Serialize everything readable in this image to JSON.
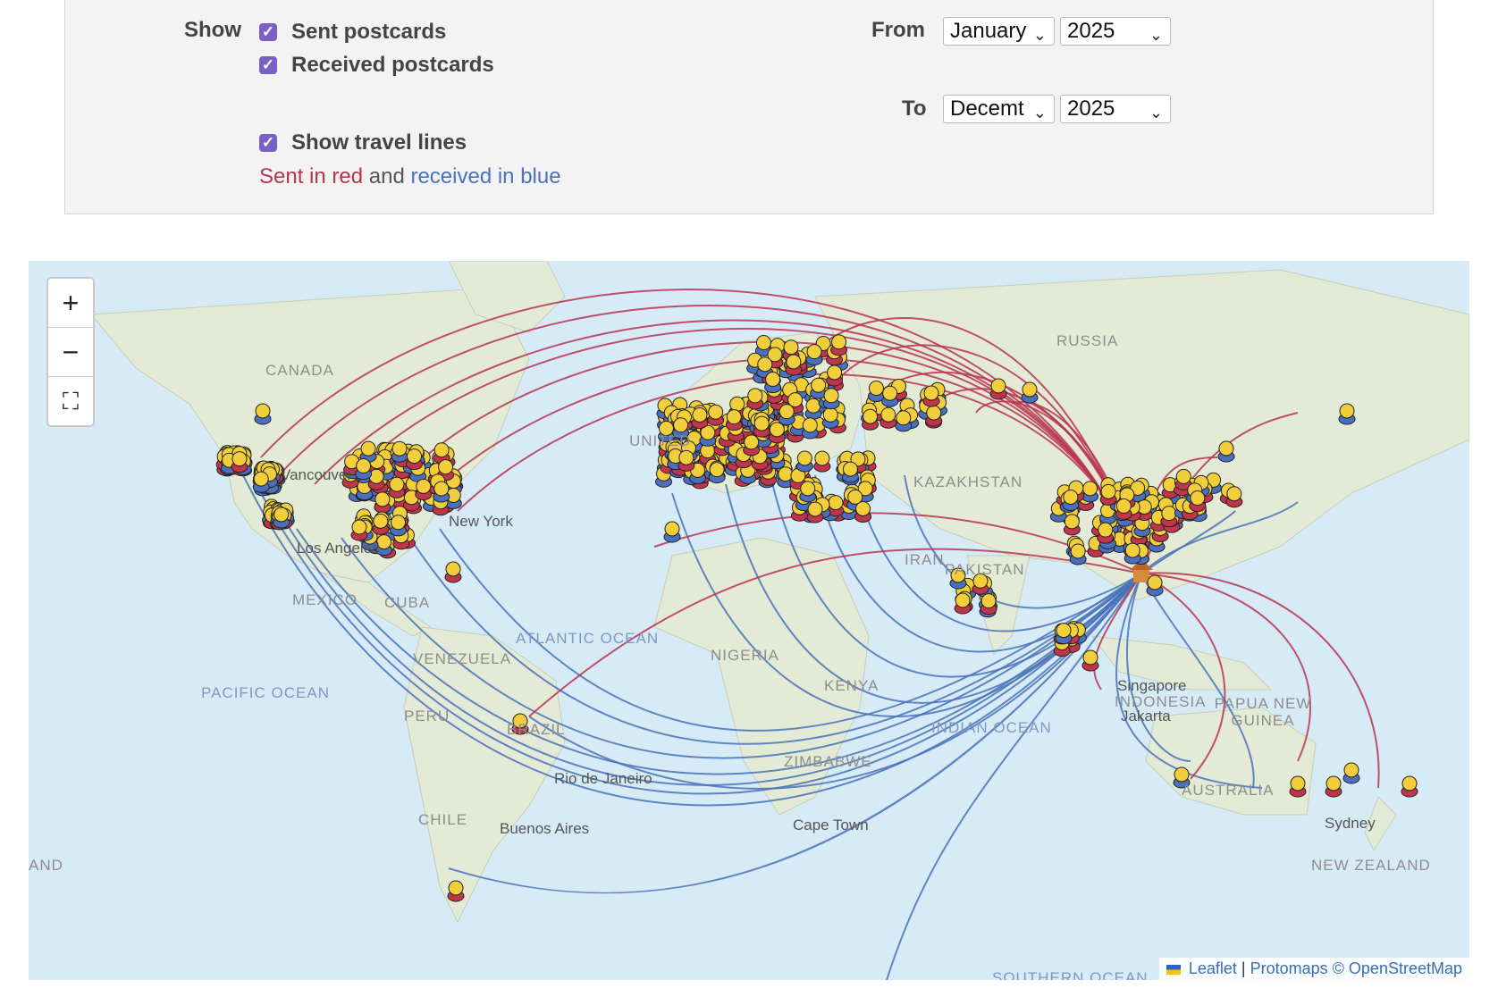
{
  "filters": {
    "show_label": "Show",
    "sent_label": "Sent postcards",
    "received_label": "Received postcards",
    "travel_lines_label": "Show travel lines",
    "sent_checked": true,
    "received_checked": true,
    "travel_lines_checked": true,
    "from_label": "From",
    "to_label": "To",
    "from_month": "January",
    "from_year": "2025",
    "to_month": "Decemt",
    "to_year": "2025",
    "legend": {
      "sent": "Sent in red",
      "and": "and",
      "received": "received in blue"
    },
    "colors": {
      "sent": "#b8344f",
      "received": "#4a72b8",
      "checkbox": "#7b5fc4"
    }
  },
  "map": {
    "zoom_in": "+",
    "zoom_out": "−",
    "fullscreen": "⛶",
    "region_labels": [
      "CANADA",
      "RUSSIA",
      "KAZAKHSTAN",
      "MEXICO",
      "CUBA",
      "VENEZUELA",
      "PERU",
      "BRAZIL",
      "CHILE",
      "NIGERIA",
      "KENYA",
      "ZIMBABWE",
      "INDONESIA",
      "PAPUA NEW GUINEA",
      "AUSTRALIA",
      "NEW ZEALAND",
      "PAKISTAN",
      "IRAN",
      "UNITED",
      "AND"
    ],
    "ocean_labels": [
      "PACIFIC OCEAN",
      "ATLANTIC OCEAN",
      "INDIAN OCEAN",
      "SOUTHERN OCEAN"
    ],
    "city_labels": [
      "Vancouver",
      "New York",
      "Rio de Janeiro",
      "Buenos Aires",
      "Cape Town",
      "Singapore",
      "Jakarta",
      "Sydney",
      "Los Angeles"
    ],
    "attribution": {
      "leaflet": "Leaflet",
      "sep": "|",
      "protomaps": "Protomaps",
      "osm": "© OpenStreetMap"
    }
  }
}
